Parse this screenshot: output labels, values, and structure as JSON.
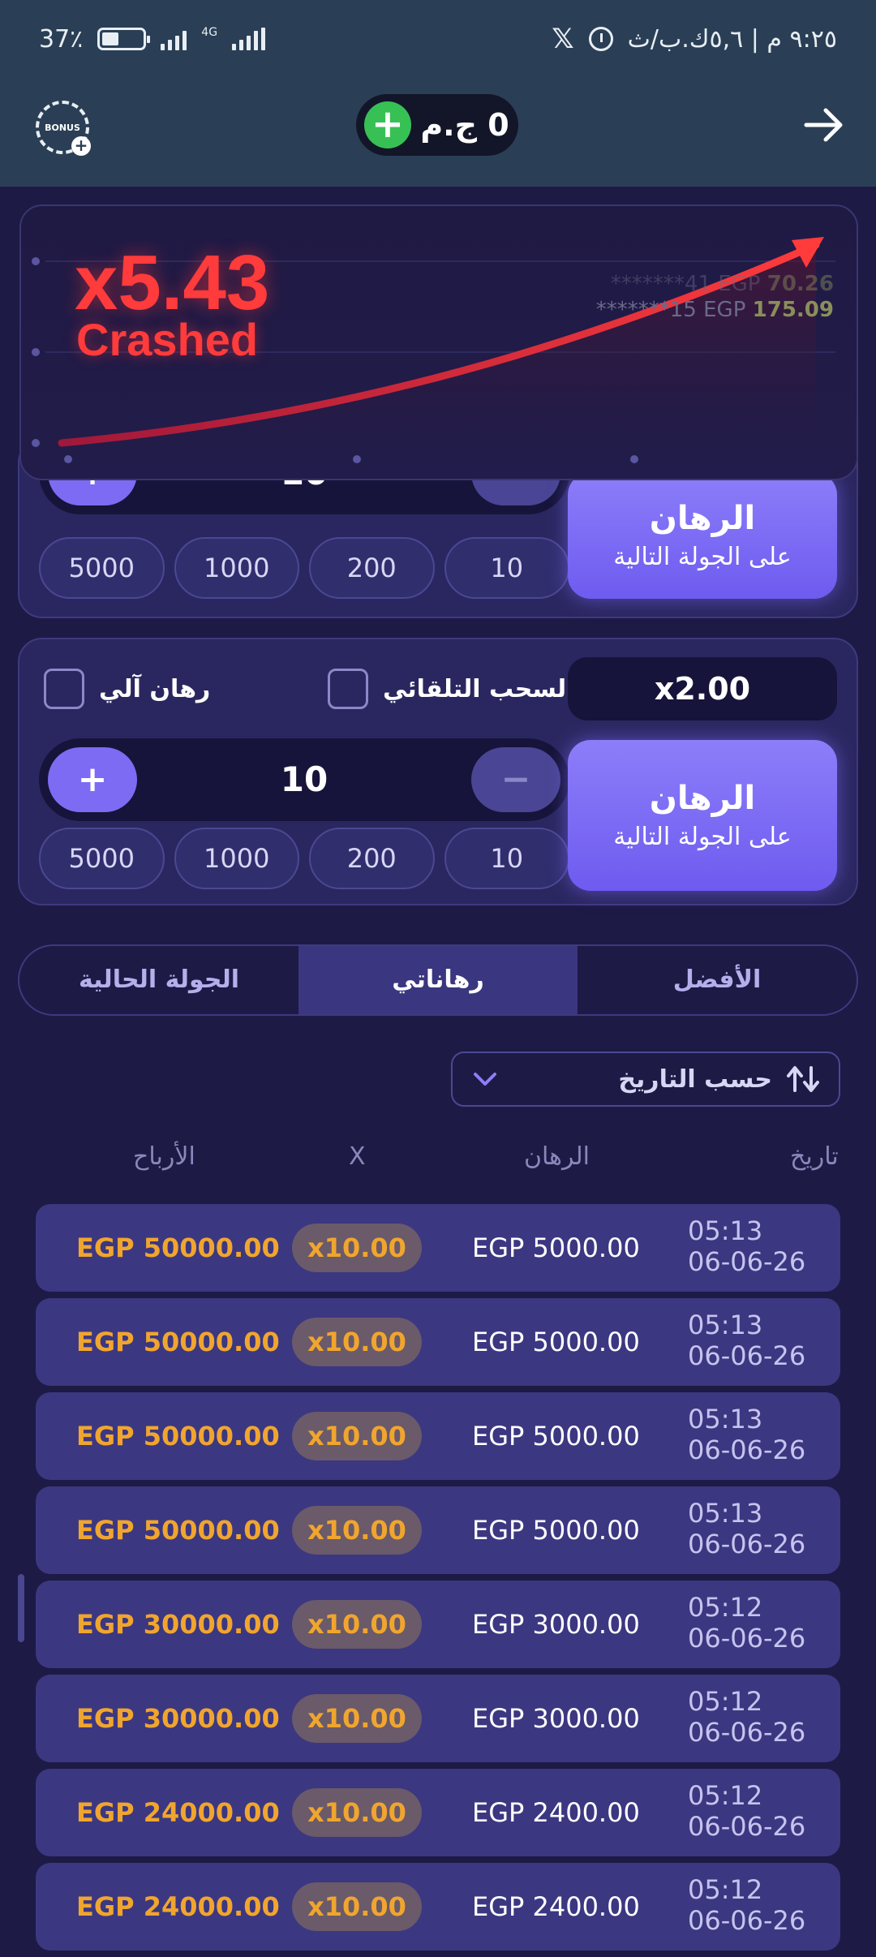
{
  "status_bar": {
    "battery": "37٪",
    "network": "4G",
    "right_text": "٩:٢٥ م | ٥,٦ك.ب/ث"
  },
  "header": {
    "bonus_label": "BONUS",
    "balance": "0 ج.م"
  },
  "round": {
    "multiplier": "x5.43",
    "status": "Crashed",
    "feed": [
      {
        "user": "*******41",
        "currency": "EGP",
        "amount": "70.26"
      },
      {
        "user": "*******15",
        "currency": "EGP",
        "amount": "175.09"
      }
    ]
  },
  "bet_panel_1": {
    "stake": "10",
    "chips": [
      "5000",
      "1000",
      "200",
      "10"
    ],
    "button_main": "الرهان",
    "button_sub": "على الجولة التالية"
  },
  "bet_panel_2": {
    "auto_bet_label": "رهان آلي",
    "auto_cashout_label": "-السحب التلقائي",
    "cashout_value": "x2.00",
    "stake": "10",
    "chips": [
      "5000",
      "1000",
      "200",
      "10"
    ],
    "button_main": "الرهان",
    "button_sub": "على الجولة التالية"
  },
  "tabs": [
    "الجولة الحالية",
    "رهاناتي",
    "الأفضل"
  ],
  "active_tab": 1,
  "sort": {
    "label": "حسب التاريخ"
  },
  "table": {
    "headers": {
      "wins": "الأرباح",
      "x": "X",
      "bet": "الرهان",
      "date": "تاريخ"
    },
    "rows": [
      {
        "win": "EGP 50000.00",
        "mult": "x10.00",
        "bet": "EGP 5000.00",
        "time": "05:13",
        "date": "06-06-26"
      },
      {
        "win": "EGP 50000.00",
        "mult": "x10.00",
        "bet": "EGP 5000.00",
        "time": "05:13",
        "date": "06-06-26"
      },
      {
        "win": "EGP 50000.00",
        "mult": "x10.00",
        "bet": "EGP 5000.00",
        "time": "05:13",
        "date": "06-06-26"
      },
      {
        "win": "EGP 50000.00",
        "mult": "x10.00",
        "bet": "EGP 5000.00",
        "time": "05:13",
        "date": "06-06-26"
      },
      {
        "win": "EGP 30000.00",
        "mult": "x10.00",
        "bet": "EGP 3000.00",
        "time": "05:12",
        "date": "06-06-26"
      },
      {
        "win": "EGP 30000.00",
        "mult": "x10.00",
        "bet": "EGP 3000.00",
        "time": "05:12",
        "date": "06-06-26"
      },
      {
        "win": "EGP 24000.00",
        "mult": "x10.00",
        "bet": "EGP 2400.00",
        "time": "05:12",
        "date": "06-06-26"
      },
      {
        "win": "EGP 24000.00",
        "mult": "x10.00",
        "bet": "EGP 2400.00",
        "time": "05:12",
        "date": "06-06-26"
      }
    ]
  },
  "colors": {
    "accent": "#7d6bf3",
    "crash": "#ff3b3b",
    "win": "#f0a52e",
    "success": "#37c154"
  }
}
